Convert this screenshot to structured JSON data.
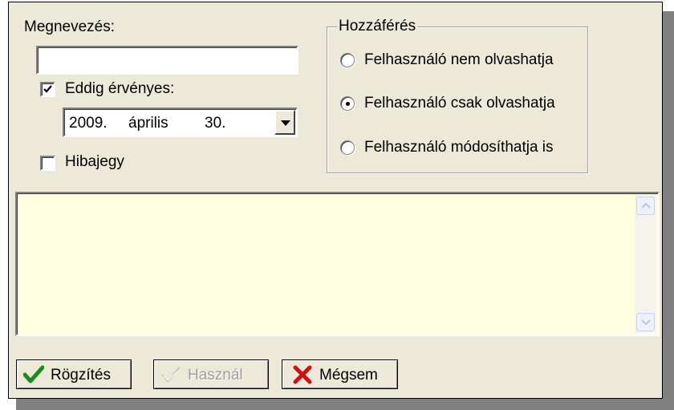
{
  "form": {
    "name_label": "Megnevezés:",
    "name_value": "",
    "valid_until": {
      "label": "Eddig érvényes:",
      "checked": true,
      "date_year": "2009.",
      "date_month": "április",
      "date_day": "30."
    },
    "bug_ticket": {
      "label": "Hibajegy",
      "checked": false
    }
  },
  "access": {
    "title": "Hozzáférés",
    "options": [
      {
        "label": "Felhasználó nem olvashatja",
        "selected": false
      },
      {
        "label": "Felhasználó csak olvashatja",
        "selected": true
      },
      {
        "label": "Felhasználó módosíthatja is",
        "selected": false
      }
    ]
  },
  "memo": {
    "text": ""
  },
  "buttons": {
    "record": "Rögzítés",
    "use": "Használ",
    "cancel": "Mégsem"
  },
  "colors": {
    "window_bg": "#ece9d8",
    "memo_bg": "#ffffe1",
    "check_green": "#1a8a1a",
    "cancel_red": "#d01010"
  }
}
